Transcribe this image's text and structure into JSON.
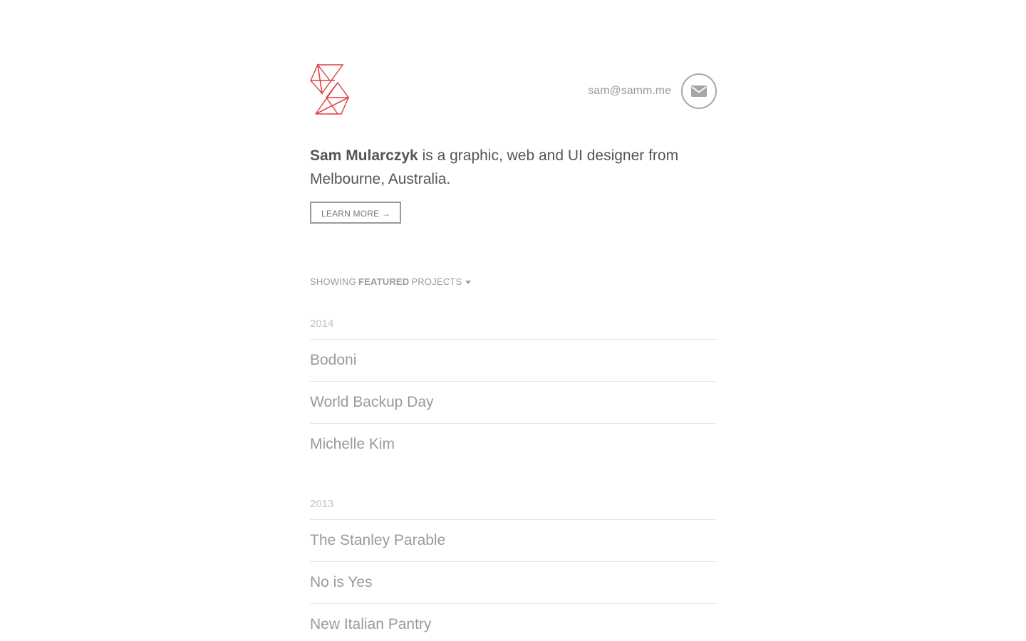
{
  "header": {
    "email": "sam@samm.me",
    "email_icon": "envelope-icon",
    "logo_icon": "triangle-monogram-logo",
    "logo_color": "#e03c43"
  },
  "intro": {
    "name": "Sam Mularczyk",
    "text": " is a graphic, web and UI designer from Melbourne, Australia.",
    "learn_more_label": "LEARN MORE →"
  },
  "filter": {
    "prefix": "SHOWING",
    "selected": "FEATURED",
    "suffix": "PROJECTS"
  },
  "projects": [
    {
      "year": "2014",
      "items": [
        "Bodoni",
        "World Backup Day",
        "Michelle Kim"
      ]
    },
    {
      "year": "2013",
      "items": [
        "The Stanley Parable",
        "No is Yes",
        "New Italian Pantry"
      ]
    }
  ]
}
